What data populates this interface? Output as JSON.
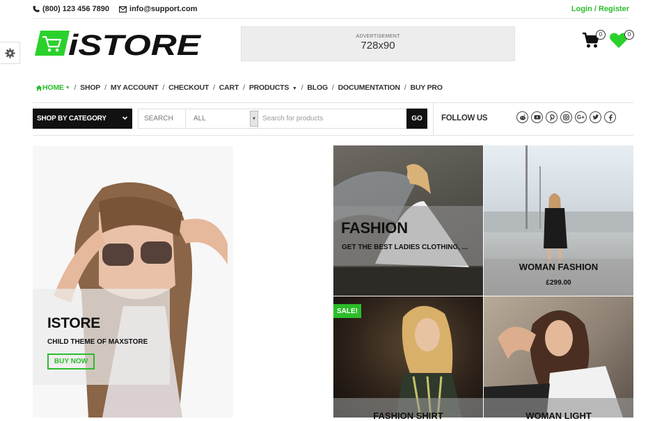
{
  "topbar": {
    "phone": "(800) 123 456 7890",
    "email": "info@support.com",
    "login": "Login / Register"
  },
  "logo": {
    "text": "iSTORE"
  },
  "ad": {
    "small": "ADVERTISEMENT",
    "size": "728x90"
  },
  "header": {
    "cart_count": "0",
    "wishlist_count": "0"
  },
  "nav": {
    "items": [
      {
        "label": "HOME"
      },
      {
        "label": "SHOP"
      },
      {
        "label": "MY ACCOUNT"
      },
      {
        "label": "CHECKOUT"
      },
      {
        "label": "CART"
      },
      {
        "label": "PRODUCTS"
      },
      {
        "label": "BLOG"
      },
      {
        "label": "DOCUMENTATION"
      },
      {
        "label": "BUY PRO"
      }
    ],
    "separator": "/"
  },
  "search": {
    "category_button": "SHOP BY CATEGORY",
    "label": "SEARCH",
    "selected": "ALL",
    "placeholder": "Search for products",
    "go": "GO"
  },
  "follow": {
    "label": "FOLLOW US",
    "networks": [
      "reddit-icon",
      "youtube-icon",
      "pinterest-icon",
      "instagram-icon",
      "google-plus-icon",
      "twitter-icon",
      "facebook-icon"
    ]
  },
  "hero": {
    "title": "ISTORE",
    "subtitle": "CHILD THEME OF MAXSTORE",
    "button": "BUY NOW"
  },
  "tiles": {
    "fashion_title": "FASHION",
    "fashion_sub": "GET THE BEST LADIES CLOTHING, ...",
    "woman_fashion_title": "WOMAN FASHION",
    "woman_fashion_price": "£299.00",
    "sale_badge": "SALE!",
    "fashion_shirt_title": "FASHION SHIRT",
    "woman_light_title": "WOMAN LIGHT"
  },
  "colors": {
    "accent": "#2bbd2b",
    "dark": "#111111"
  }
}
